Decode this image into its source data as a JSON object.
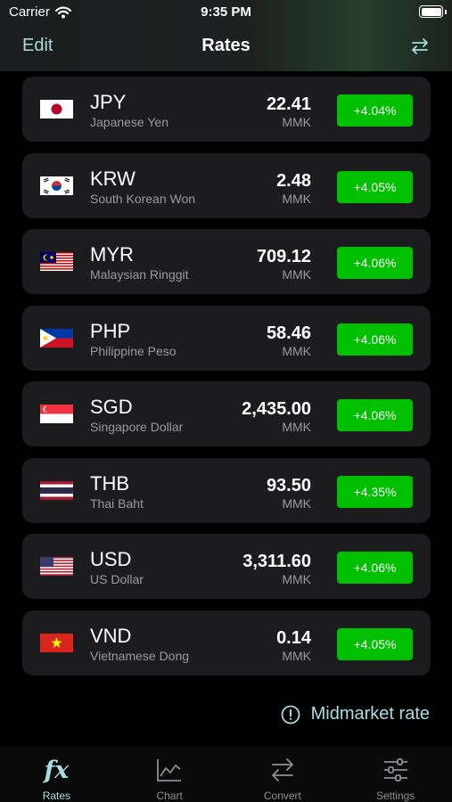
{
  "status_bar": {
    "carrier": "Carrier",
    "time": "9:35 PM"
  },
  "nav": {
    "edit_label": "Edit",
    "title": "Rates",
    "swap_icon": "swap-arrows-icon"
  },
  "rates": [
    {
      "code": "JPY",
      "name": "Japanese Yen",
      "value": "22.41",
      "unit": "MMK",
      "change": "+4.04%",
      "flag": "flag-japan"
    },
    {
      "code": "KRW",
      "name": "South Korean Won",
      "value": "2.48",
      "unit": "MMK",
      "change": "+4.05%",
      "flag": "flag-south-korea"
    },
    {
      "code": "MYR",
      "name": "Malaysian Ringgit",
      "value": "709.12",
      "unit": "MMK",
      "change": "+4.06%",
      "flag": "flag-malaysia"
    },
    {
      "code": "PHP",
      "name": "Philippine Peso",
      "value": "58.46",
      "unit": "MMK",
      "change": "+4.06%",
      "flag": "flag-philippines"
    },
    {
      "code": "SGD",
      "name": "Singapore Dollar",
      "value": "2,435.00",
      "unit": "MMK",
      "change": "+4.06%",
      "flag": "flag-singapore"
    },
    {
      "code": "THB",
      "name": "Thai Baht",
      "value": "93.50",
      "unit": "MMK",
      "change": "+4.35%",
      "flag": "flag-thailand"
    },
    {
      "code": "USD",
      "name": "US Dollar",
      "value": "3,311.60",
      "unit": "MMK",
      "change": "+4.06%",
      "flag": "flag-usa"
    },
    {
      "code": "VND",
      "name": "Vietnamese Dong",
      "value": "0.14",
      "unit": "MMK",
      "change": "+4.05%",
      "flag": "flag-vietnam"
    }
  ],
  "footer": {
    "midmarket_label": "Midmarket rate"
  },
  "tabs": [
    {
      "label": "Rates",
      "icon": "fx-icon",
      "icon_text": "fx",
      "active": true
    },
    {
      "label": "Chart",
      "icon": "chart-icon",
      "active": false
    },
    {
      "label": "Convert",
      "icon": "convert-icon",
      "active": false
    },
    {
      "label": "Settings",
      "icon": "sliders-icon",
      "active": false
    }
  ],
  "colors": {
    "accent": "#a9dde0",
    "positive": "#00c000",
    "card": "#1c1c1e",
    "secondary_text": "#9a9a9e"
  }
}
